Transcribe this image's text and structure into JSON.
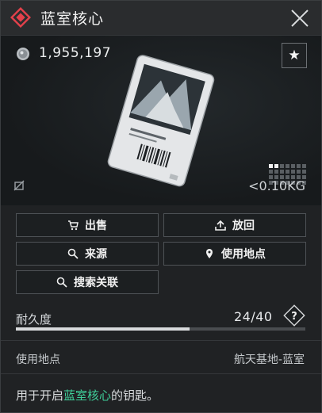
{
  "window": {
    "title": "蓝室核心"
  },
  "item": {
    "price": "1,955,197",
    "weight": "<0.10KG",
    "icons": {
      "currency": "coin-icon",
      "favorite": "star-icon",
      "no_share": "no-share-icon",
      "grid": "grid-icon"
    }
  },
  "actions": {
    "sell": "出售",
    "return": "放回",
    "source": "来源",
    "use_location": "使用地点",
    "search_related": "搜索关联"
  },
  "durability": {
    "label": "耐久度",
    "value": "24/40",
    "current": 24,
    "max": 40
  },
  "location": {
    "label": "使用地点",
    "value": "航天基地-蓝室"
  },
  "description": {
    "prefix": "用于开启",
    "highlight": "蓝室核心",
    "suffix": "的钥匙。"
  },
  "colors": {
    "accent": "#e3414b",
    "highlight": "#3fd09a",
    "bar": "#d8dadc"
  }
}
